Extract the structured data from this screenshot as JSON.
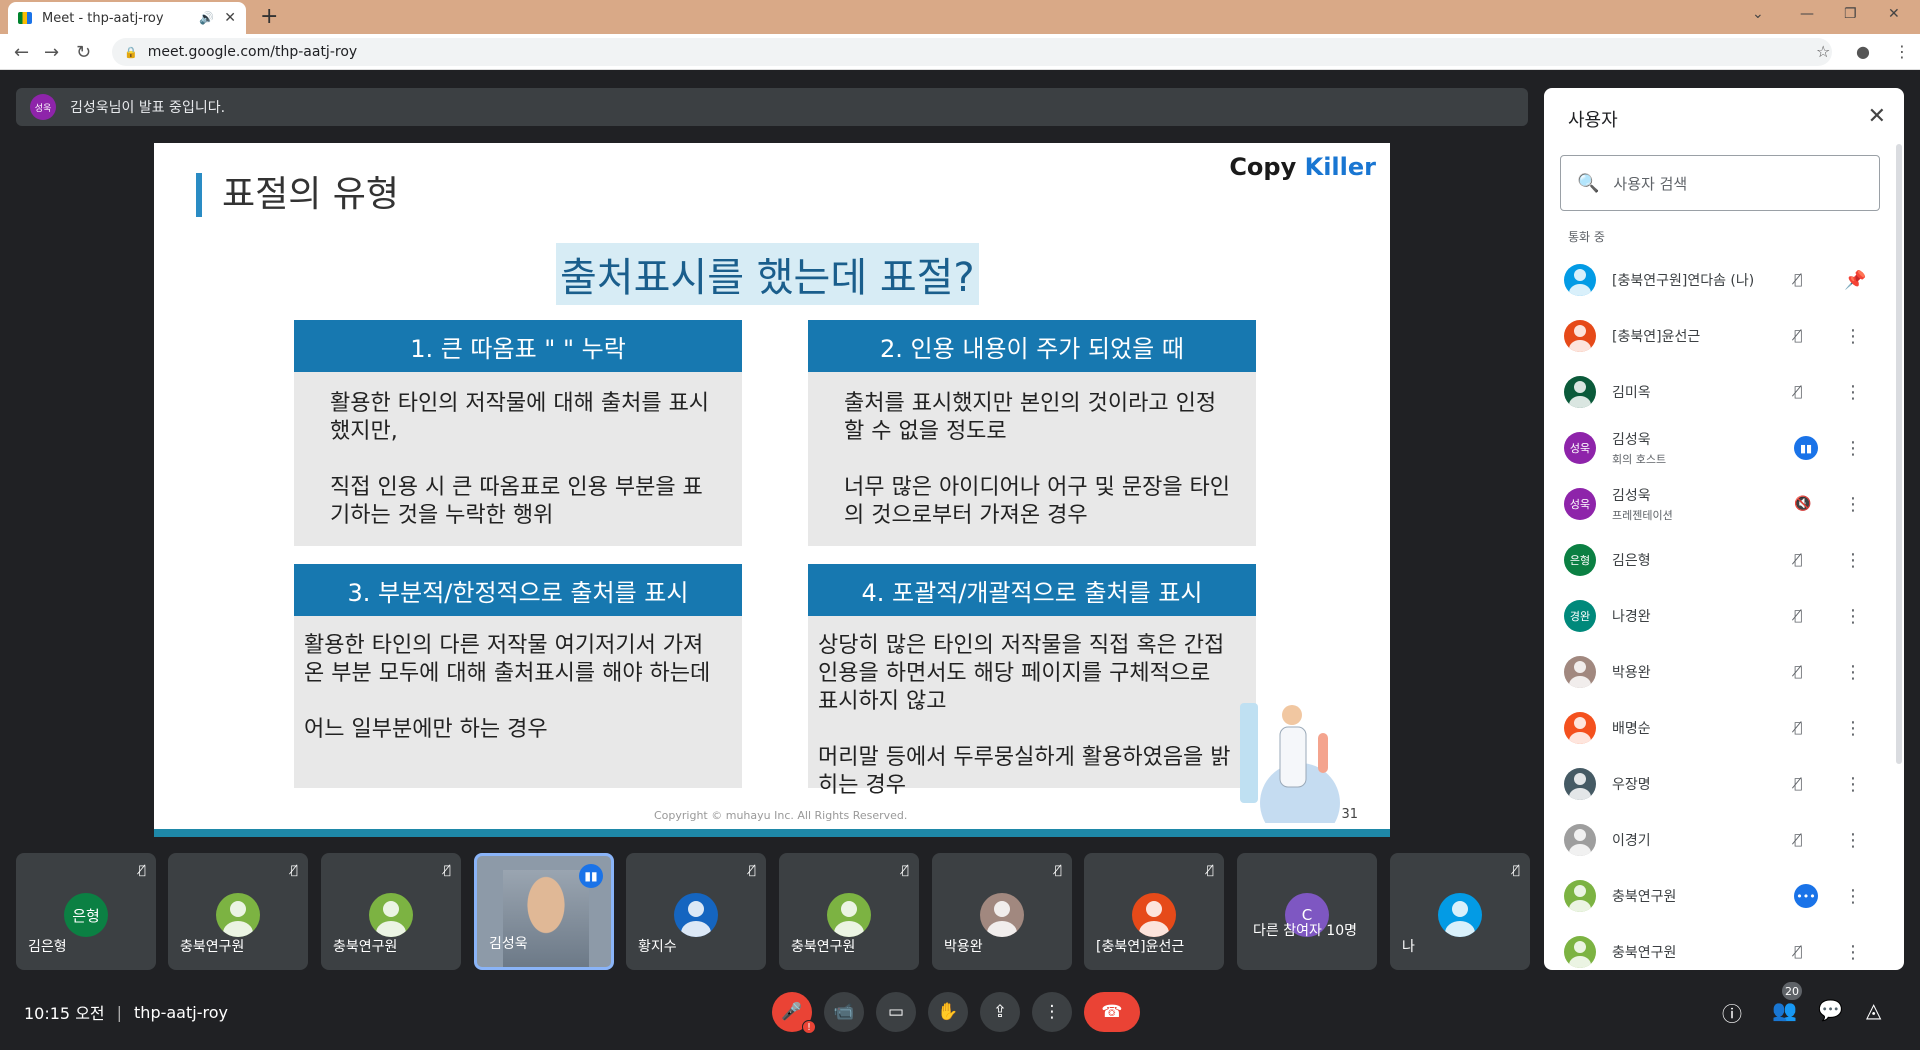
{
  "browser": {
    "tab_title": "Meet - thp-aatj-roy",
    "url": "meet.google.com/thp-aatj-roy"
  },
  "banner": {
    "avatar_text": "성욱",
    "text": "김성욱님이 발표 중입니다."
  },
  "slide": {
    "title": "표절의 유형",
    "logo_copy": "Copy",
    "logo_killer": "Killer",
    "headline": "출처표시를 했는데 표절?",
    "cards": [
      {
        "head": "1. 큰 따옴표 \" \" 누락",
        "lines": [
          "활용한 타인의 저작물에 대해 출처를 표시했지만,",
          "직접 인용 시 큰 따옴표로 인용 부분을 표기하는 것을 누락한 행위"
        ]
      },
      {
        "head": "2. 인용 내용이 주가 되었을 때",
        "lines": [
          "출처를 표시했지만 본인의 것이라고 인정할 수 없을 정도로",
          "너무 많은 아이디어나 어구 및 문장을 타인의 것으로부터 가져온 경우"
        ]
      },
      {
        "head": "3. 부분적/한정적으로 출처를 표시",
        "lines": [
          "활용한 타인의 다른 저작물 여기저기서 가져온 부분 모두에 대해 출처표시를 해야 하는데",
          "어느 일부분에만 하는 경우"
        ]
      },
      {
        "head": "4. 포괄적/개괄적으로 출처를 표시",
        "lines": [
          "상당히 많은 타인의 저작물을 직접 혹은 간접 인용을 하면서도 해당 페이지를 구체적으로 표시하지 않고",
          "머리말 등에서 두루뭉실하게 활용하였음을 밝히는 경우"
        ]
      }
    ],
    "copyright": "Copyright © muhayu Inc. All Rights Reserved.",
    "page_number": "31"
  },
  "tiles": [
    {
      "name": "김은형",
      "avatar": "은형",
      "color": "#0b8043"
    },
    {
      "name": "충북연구원",
      "avatar": "",
      "color": "#7cb342"
    },
    {
      "name": "충북연구원",
      "avatar": "",
      "color": "#7cb342"
    },
    {
      "name": "김성욱",
      "avatar": "",
      "color": ""
    },
    {
      "name": "황지수",
      "avatar": "",
      "color": "#1565c0"
    },
    {
      "name": "충북연구원",
      "avatar": "",
      "color": "#7cb342"
    },
    {
      "name": "박용완",
      "avatar": "",
      "color": "#a1887f"
    },
    {
      "name": "[충북연]윤선근",
      "avatar": "",
      "color": "#e64a19"
    },
    {
      "name": "다른 참여자 10명",
      "avatar": "C",
      "color": "#7e57c2"
    },
    {
      "name": "나",
      "avatar": "",
      "color": "#039be5"
    }
  ],
  "bottom": {
    "time": "10:15 오전",
    "meeting_code": "thp-aatj-roy",
    "participant_count": "20"
  },
  "panel": {
    "title": "사용자",
    "search_placeholder": "사용자 검색",
    "section": "통화 중",
    "participants": [
      {
        "name": "[충북연구원]연다솜 (나)",
        "sub": "",
        "avatar": "",
        "color": "#039be5"
      },
      {
        "name": "[충북연]윤선근",
        "sub": "",
        "avatar": "",
        "color": "#e64a19"
      },
      {
        "name": "김미옥",
        "sub": "",
        "avatar": "",
        "color": "#0b5a3a"
      },
      {
        "name": "김성욱",
        "sub": "회의 호스트",
        "avatar": "성욱",
        "color": "#8e24aa"
      },
      {
        "name": "김성욱",
        "sub": "프레젠테이션",
        "avatar": "성욱",
        "color": "#8e24aa"
      },
      {
        "name": "김은형",
        "sub": "",
        "avatar": "은형",
        "color": "#0b8043"
      },
      {
        "name": "나경완",
        "sub": "",
        "avatar": "경완",
        "color": "#00897b"
      },
      {
        "name": "박용완",
        "sub": "",
        "avatar": "",
        "color": "#a1887f"
      },
      {
        "name": "배명순",
        "sub": "",
        "avatar": "",
        "color": "#f4511e"
      },
      {
        "name": "우장명",
        "sub": "",
        "avatar": "",
        "color": "#455a64"
      },
      {
        "name": "이경기",
        "sub": "",
        "avatar": "",
        "color": "#9e9e9e"
      },
      {
        "name": "충북연구원",
        "sub": "",
        "avatar": "",
        "color": "#7cb342"
      },
      {
        "name": "충북연구원",
        "sub": "",
        "avatar": "",
        "color": "#7cb342"
      }
    ]
  }
}
